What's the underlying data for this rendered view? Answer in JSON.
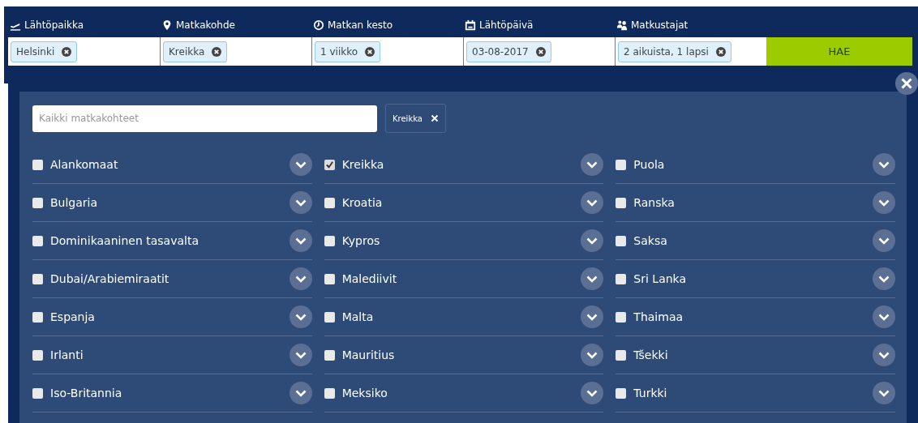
{
  "search_bar": {
    "fields": [
      {
        "label": "Lähtöpaikka",
        "value": "Helsinki"
      },
      {
        "label": "Matkakohde",
        "value": "Kreikka"
      },
      {
        "label": "Matkan kesto",
        "value": "1 viikko"
      },
      {
        "label": "Lähtöpäivä",
        "value": "03-08-2017"
      },
      {
        "label": "Matkustajat",
        "value": "2 aikuista, 1 lapsi"
      }
    ],
    "button": "HAE"
  },
  "destination_panel": {
    "search": {
      "placeholder": "Kaikki matkakohteet"
    },
    "chips": [
      "Kreikka"
    ],
    "columns": [
      [
        {
          "name": "Alankomaat",
          "checked": false
        },
        {
          "name": "Bulgaria",
          "checked": false
        },
        {
          "name": "Dominikaaninen tasavalta",
          "checked": false
        },
        {
          "name": "Dubai/Arabiemiraatit",
          "checked": false
        },
        {
          "name": "Espanja",
          "checked": false
        },
        {
          "name": "Irlanti",
          "checked": false
        },
        {
          "name": "Iso-Britannia",
          "checked": false
        }
      ],
      [
        {
          "name": "Kreikka",
          "checked": true
        },
        {
          "name": "Kroatia",
          "checked": false
        },
        {
          "name": "Kypros",
          "checked": false
        },
        {
          "name": "Malediivit",
          "checked": false
        },
        {
          "name": "Malta",
          "checked": false
        },
        {
          "name": "Mauritius",
          "checked": false
        },
        {
          "name": "Meksiko",
          "checked": false
        }
      ],
      [
        {
          "name": "Puola",
          "checked": false
        },
        {
          "name": "Ranska",
          "checked": false
        },
        {
          "name": "Saksa",
          "checked": false
        },
        {
          "name": "Sri Lanka",
          "checked": false
        },
        {
          "name": "Thaimaa",
          "checked": false
        },
        {
          "name": "Tšekki",
          "checked": false
        },
        {
          "name": "Turkki",
          "checked": false
        }
      ]
    ]
  }
}
